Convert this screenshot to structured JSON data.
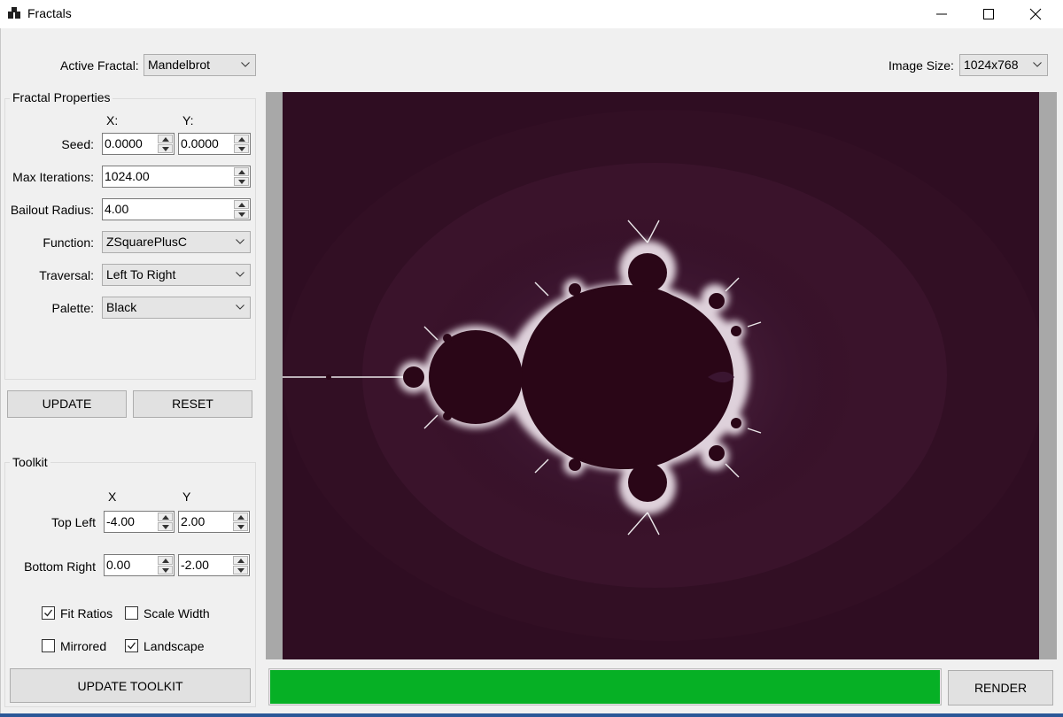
{
  "window": {
    "title": "Fractals"
  },
  "top": {
    "active_fractal_label": "Active Fractal:",
    "active_fractal_value": "Mandelbrot",
    "image_size_label": "Image Size:",
    "image_size_value": "1024x768"
  },
  "properties": {
    "group_title": "Fractal Properties",
    "x_header": "X:",
    "y_header": "Y:",
    "seed_label": "Seed:",
    "seed_x": "0.0000",
    "seed_y": "0.0000",
    "max_iterations_label": "Max Iterations:",
    "max_iterations": "1024.00",
    "bailout_label": "Bailout Radius:",
    "bailout": "4.00",
    "function_label": "Function:",
    "function_value": "ZSquarePlusC",
    "traversal_label": "Traversal:",
    "traversal_value": "Left To Right",
    "palette_label": "Palette:",
    "palette_value": "Black",
    "update_label": "UPDATE",
    "reset_label": "RESET"
  },
  "toolkit": {
    "group_title": "Toolkit",
    "x_header": "X",
    "y_header": "Y",
    "top_left_label": "Top Left",
    "top_left_x": "-4.00",
    "top_left_y": "2.00",
    "bottom_right_label": "Bottom Right",
    "bottom_right_x": "0.00",
    "bottom_right_y": "-2.00",
    "fit_ratios_label": "Fit Ratios",
    "fit_ratios_checked": true,
    "scale_width_label": "Scale Width",
    "scale_width_checked": false,
    "mirrored_label": "Mirrored",
    "mirrored_checked": false,
    "landscape_label": "Landscape",
    "landscape_checked": true,
    "update_toolkit_label": "UPDATE TOOLKIT"
  },
  "render": {
    "render_label": "RENDER",
    "progress": 1.0,
    "progress_color": "#06b025"
  },
  "fractal_colors": {
    "background": "#2f0d22",
    "interior": "#2a0617",
    "glow": "#f4eef3"
  },
  "icons": {
    "app": "app-icon",
    "minimize": "minimize-icon",
    "maximize": "maximize-icon",
    "close": "close-icon",
    "dropdown": "chevron-down-icon",
    "spin_up": "spin-up-icon",
    "spin_down": "spin-down-icon",
    "checkmark": "checkmark-icon"
  }
}
